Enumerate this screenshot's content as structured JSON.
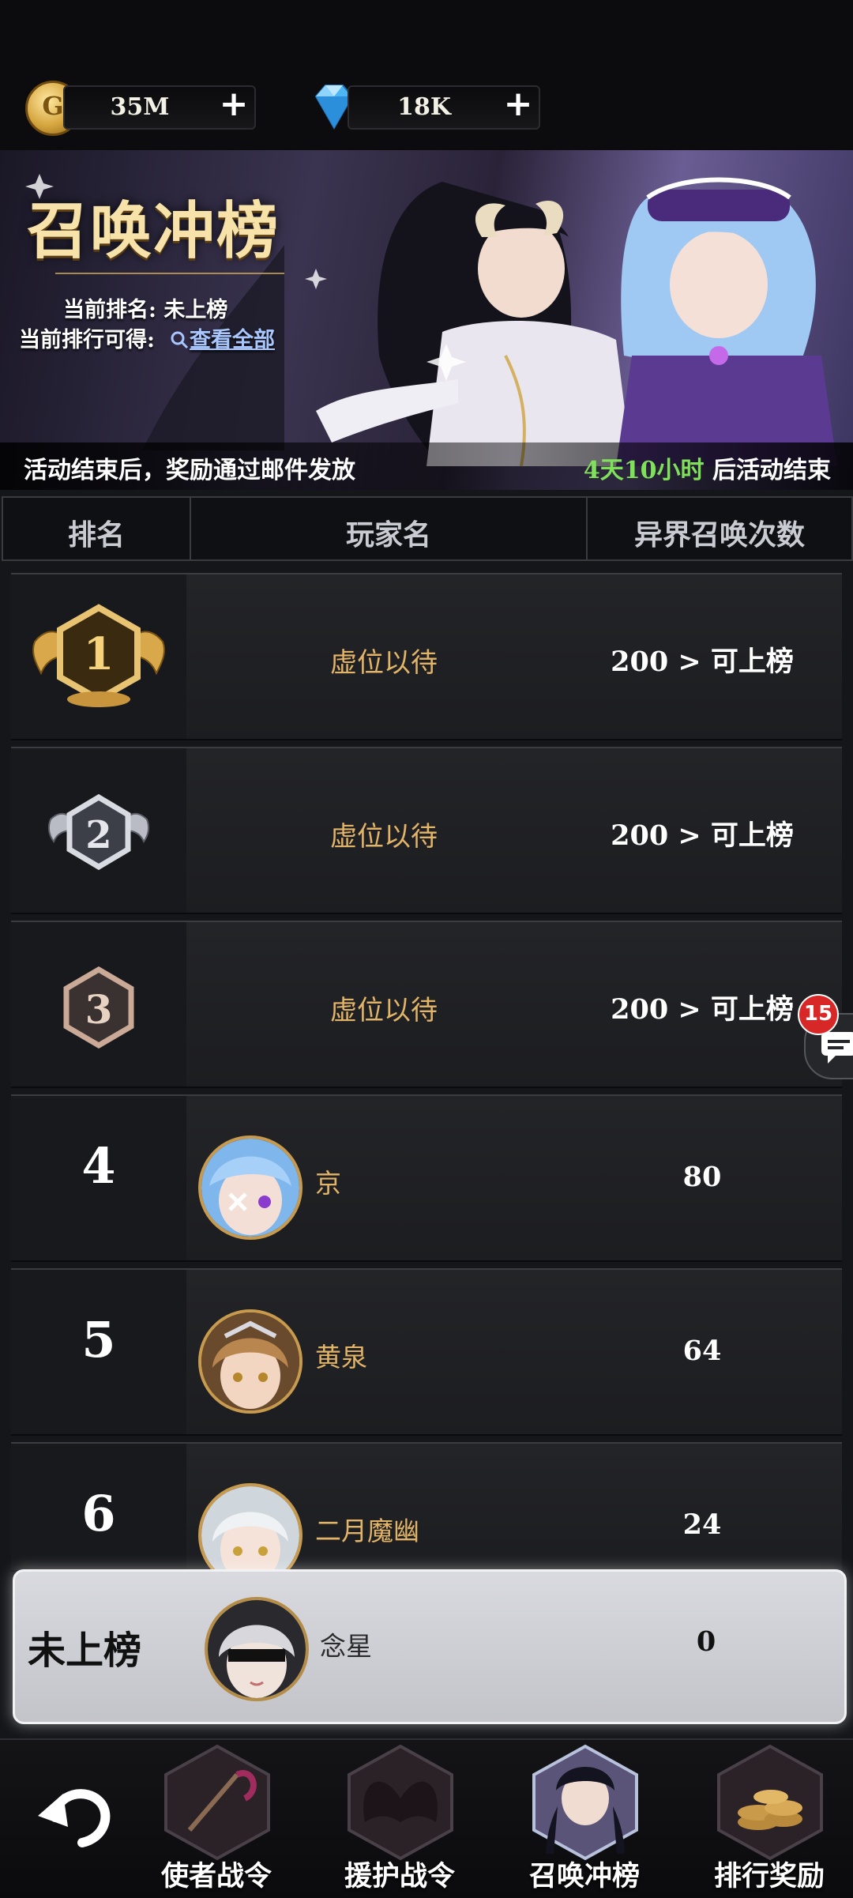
{
  "currency": {
    "gold": "35M",
    "gold_icon_glyph": "G",
    "diamonds": "18K",
    "plus": "+"
  },
  "banner": {
    "title": "召唤冲榜",
    "current_rank": "当前排名: 未上榜",
    "reward_label": "当前排行可得:",
    "view_all": "查看全部",
    "notice": "活动结束后，奖励通过邮件发放",
    "time_left": "4天10小时",
    "time_suffix": " 后活动结束"
  },
  "table": {
    "headers": [
      "排名",
      "玩家名",
      "异界召唤次数"
    ]
  },
  "rows": [
    {
      "rank": "1",
      "name": "虚位以待",
      "score": "200 > 可上榜"
    },
    {
      "rank": "2",
      "name": "虚位以待",
      "score": "200 > 可上榜"
    },
    {
      "rank": "3",
      "name": "虚位以待",
      "score": "200 > 可上榜"
    },
    {
      "rank": "4",
      "name": "京",
      "score": "80"
    },
    {
      "rank": "5",
      "name": "黄泉",
      "score": "64"
    },
    {
      "rank": "6",
      "name": "二月魔幽",
      "score": "24"
    }
  ],
  "me": {
    "rank": "未上榜",
    "name": "念星",
    "score": "0"
  },
  "chat": {
    "unread": "15"
  },
  "nav": {
    "items": [
      "使者战令",
      "援护战令",
      "召唤冲榜",
      "排行奖励"
    ],
    "active": "召唤冲榜"
  },
  "colors": {
    "gold_text": "#e2b467",
    "accent_green": "#7fe05a",
    "link_blue": "#a9c7ff",
    "badge_red": "#d82727"
  },
  "icons": {
    "coin": "gold-coin-icon",
    "gem": "diamond-icon",
    "back": "back-arrow-icon",
    "search": "search-icon",
    "chat": "chat-icon"
  }
}
